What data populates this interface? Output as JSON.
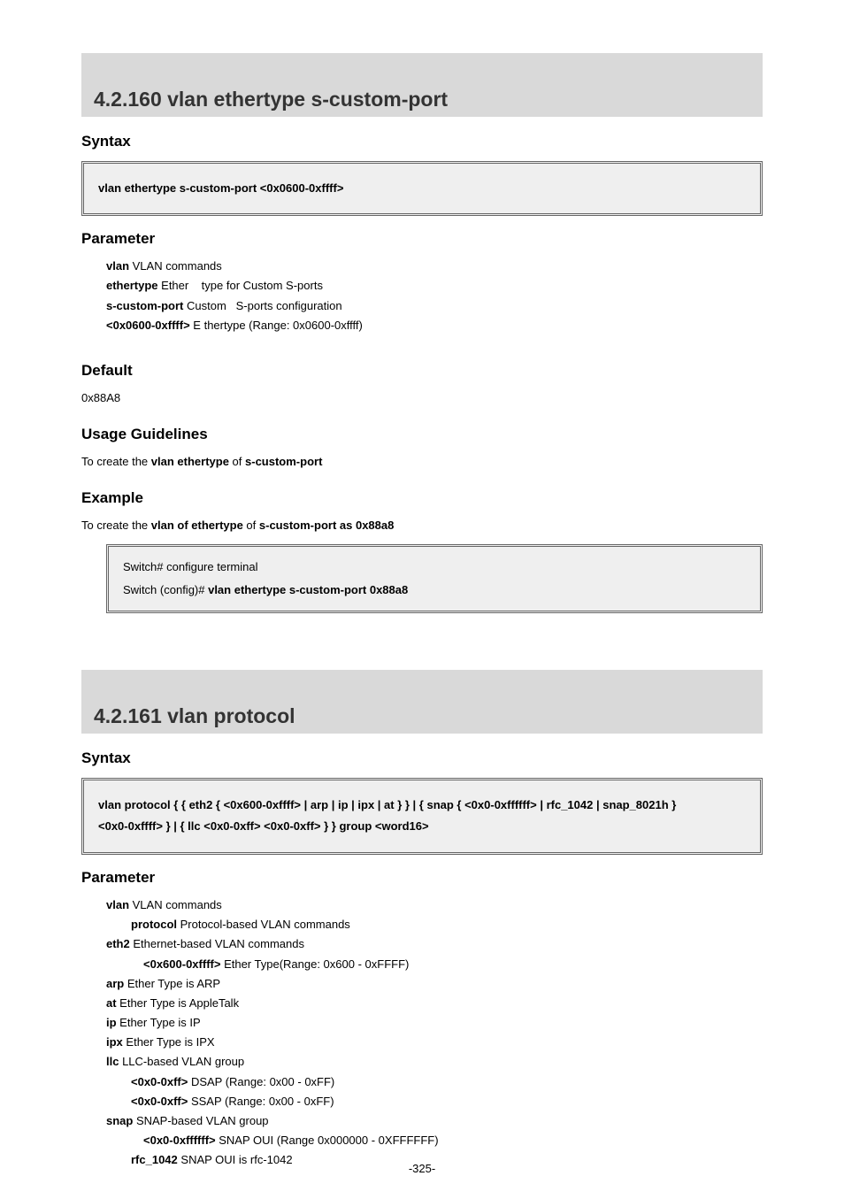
{
  "section1": {
    "title": "4.2.160 vlan ethertype s-custom-port",
    "sub_syntax": "Syntax",
    "syntax": "vlan ethertype s-custom-port <0x0600-0xffff>",
    "sub_parameter": "Parameter",
    "params": {
      "vlan_k": "vlan",
      "vlan_v": "  VLAN commands",
      "eth_k": "ethertype",
      "eth_v_a": "   Ether",
      "eth_v_b": "type for Custom S-ports",
      "scp_k": "s-custom-port",
      "scp_v_a": "   Custom",
      "scp_v_b": "S-ports configuration",
      "rng_k": "<0x0600-0xffff>",
      "rng_v_a": "  E",
      "rng_v_b": "thertype (Range: 0x0600-0xffff)"
    },
    "sub_default": "Default",
    "default_val": "0x88A8",
    "sub_usage": "Usage Guidelines",
    "usage_a": "To create the ",
    "usage_b": "vlan ethertype",
    "usage_c": " of ",
    "usage_d": "s-custom-port",
    "sub_example": "Example",
    "ex1_a": "To create the ",
    "ex1_b": "vlan of ethertype",
    "ex1_c": " of ",
    "ex1_d": "s-custom-port as 0x88a8",
    "box": {
      "l1": "Switch# configure terminal",
      "l2a": "Switch (config)# ",
      "l2b": "vlan ethertype s-custom-port 0x88a8"
    }
  },
  "section2": {
    "title": "4.2.161 vlan protocol",
    "sub_syntax": "Syntax",
    "syntax1": "vlan protocol { { eth2 { <0x600-0xffff> | arp | ip | ipx | at } } | { snap { <0x0-0xffffff> | rfc_1042 | snap_8021h }",
    "syntax2": "<0x0-0xffff> } | { llc <0x0-0xff> <0x0-0xff> } } group <word16>",
    "sub_parameter": "Parameter",
    "params": {
      "vlan_k": "vlan",
      "vlan_v": " VLAN  commands",
      "proto_k": "protocol ",
      "proto_v": " Protocol-based VLAN commands",
      "eth2_k": "eth2",
      "eth2_v": " Ethernet-based VLAN commands",
      "e2rng_k": "<0x600-0xffff>",
      "e2rng_v": " Ether Type(Range: 0x600 - 0xFFFF)",
      "arp_k": "arp",
      "arp_v": " Ether Type is ARP",
      "at_k": "at ",
      "at_v": " Ether Type is AppleTalk",
      "ip_k": "ip",
      "ip_v": " Ether Type is IP",
      "ipx_k": "ipx",
      "ipx_v": " Ether Type is IPX",
      "llc_k": "llc ",
      "llc_v": " LLC-based VLAN group",
      "dsap_k": "<0x0-0xff>",
      "dsap_v": " DSAP (Range: 0x00 - 0xFF)",
      "ssap_k": "<0x0-0xff>",
      "ssap_v": " SSAP (Range: 0x00 - 0xFF)",
      "snap_k": "snap",
      "snap_v": " SNAP-based VLAN group",
      "snaprng_k": "<0x0-0xffffff>",
      "snaprng_v": " SNAP OUI (Range 0x000000 - 0XFFFFFF)",
      "rfc_k": "rfc_1042",
      "rfc_v": " SNAP OUI is rfc-1042"
    }
  },
  "page_number": "-325-"
}
